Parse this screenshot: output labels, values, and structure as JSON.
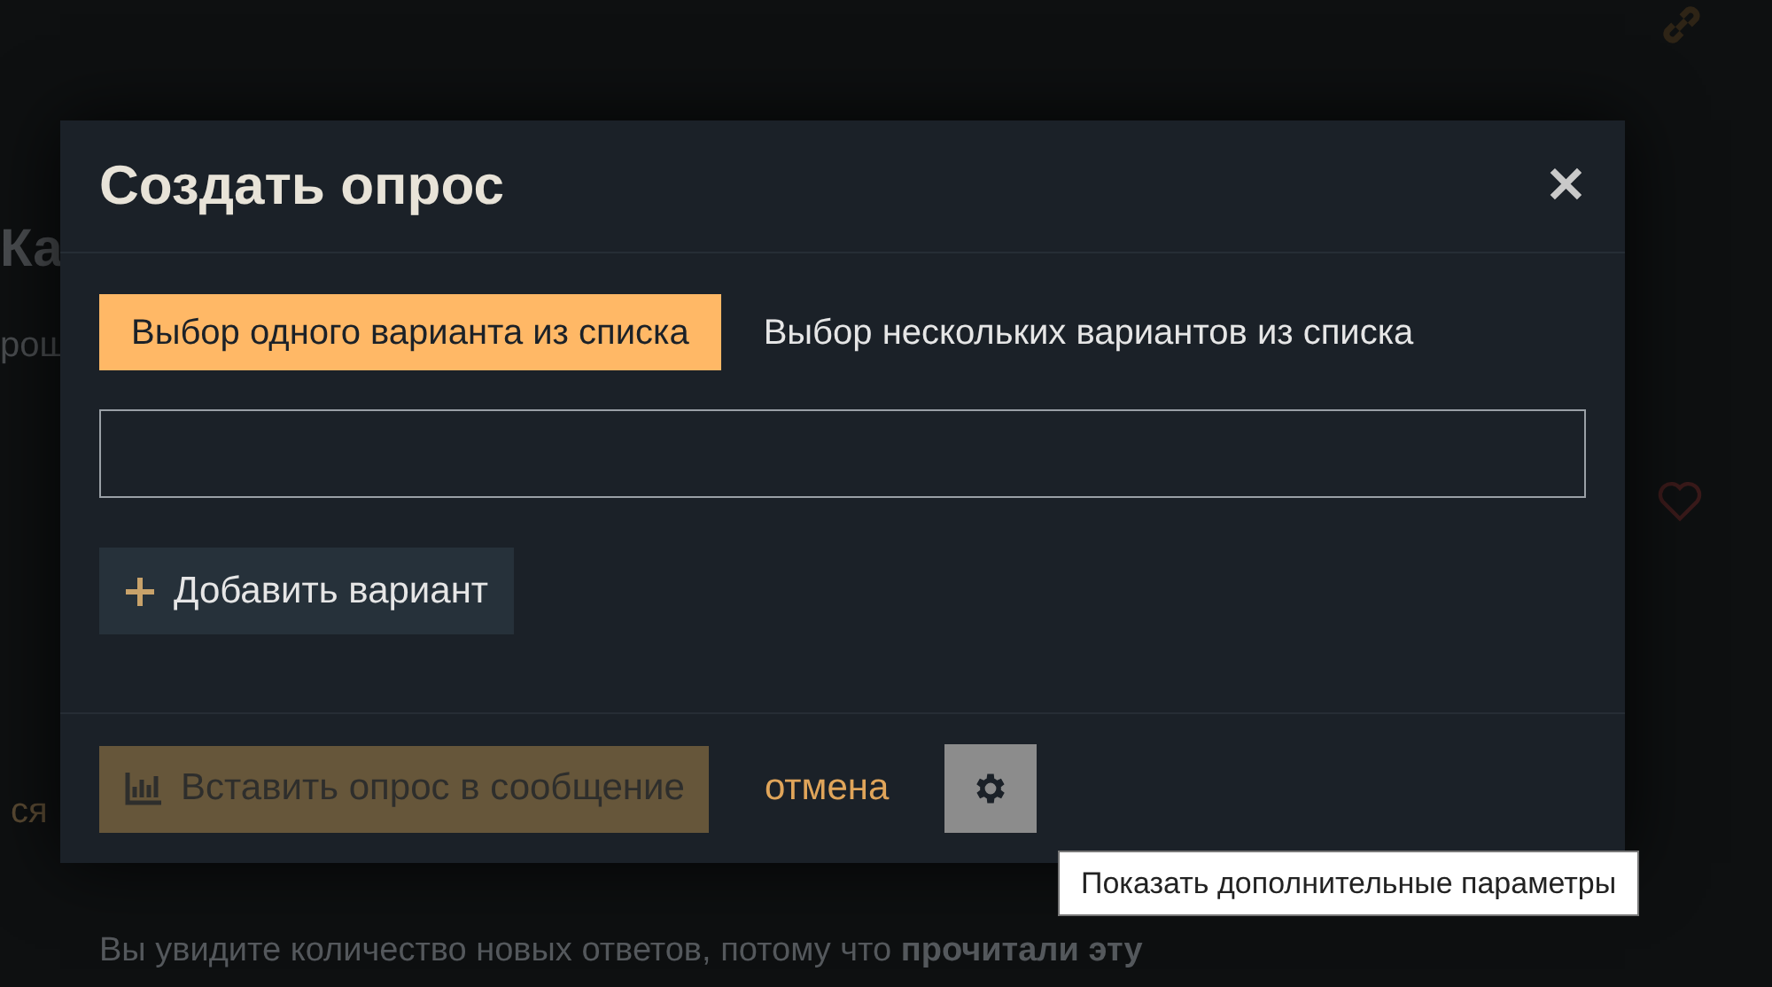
{
  "background_page": {
    "heading": "Ка",
    "subheading": "рош",
    "side_text": "ся",
    "notice": "Вы увидите количество новых ответов, потому что **прочитали эту**"
  },
  "dialog": {
    "title": "Создать опрос",
    "close_label": "✕",
    "tabs": [
      {
        "label": "Выбор одного варианта из списка",
        "selected": true
      },
      {
        "label": "Выбор нескольких вариантов из списка",
        "selected": false
      }
    ],
    "add_option": {
      "label": "Добавить вариант"
    },
    "insert_button": {
      "label": "Вставить опрос в сообщение",
      "disabled": true
    },
    "cancel": "отмена",
    "settings_tooltip": "Показать дополнительные параметры"
  }
}
